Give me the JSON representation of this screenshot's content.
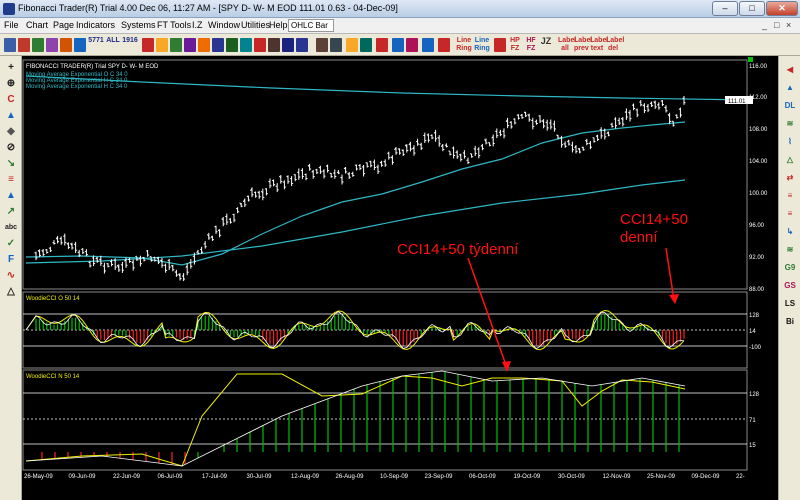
{
  "window": {
    "title": "Fibonacci Trader(R) Trial 4.00 Dec 06, 11:27 AM - [SPY D- W- M EOD  111.01   0.63 - 04-Dec-09]",
    "minimize": "–",
    "maximize": "□",
    "close": "✕"
  },
  "menu": {
    "items": [
      "File",
      "Chart",
      "Page",
      "Indicators",
      "Systems",
      "FT Tools",
      "I.Z",
      "Window",
      "Utilities",
      "Help"
    ],
    "chart_style": "OHLC Bar",
    "mdi_controls": [
      "_",
      "□",
      "×"
    ]
  },
  "toolbar": {
    "labels": [
      "5771",
      "ALL",
      "1916",
      "Line Ring",
      "Line Ring",
      "HP FZ",
      "HF FZ",
      "JZ",
      "Label all",
      "Label prev",
      "Label text",
      "Label del"
    ]
  },
  "left_tools": {
    "items": [
      "+",
      "⊕",
      "C",
      "▲",
      "◆",
      "⊘",
      "↘",
      "≡",
      "▲",
      "↗",
      "abc",
      "✓",
      "F",
      "∿",
      "△"
    ]
  },
  "right_tools": {
    "items": [
      "◀",
      "▲",
      "DL",
      "≋",
      "⌇",
      "△",
      "⇄",
      "≡",
      "≡",
      "↳",
      "≋",
      "G9",
      "GS",
      "LS",
      "Bi"
    ]
  },
  "chart": {
    "header_label": "FIBONACCI TRADER(R) Trial    SPY D- W- M EOD",
    "legend": [
      "Moving Average Exponential O C 34 0",
      "Moving Average Exponential H C 34 0",
      "Moving Average Exponential H C 34 0"
    ],
    "last_price_label": "111.01",
    "colors": {
      "background": "#000000",
      "bars": "#ffffff",
      "ma_line": "#2fb7c4",
      "cci_line": "#f0f000",
      "cci_hist": "#00c000",
      "cci_neg": "#ff2020",
      "annotation": "#ff1010",
      "grid": "#ffffff"
    },
    "price_panel": {
      "yticks": [
        "116.00",
        "112.00",
        "108.00",
        "104.00",
        "100.00",
        "96.00",
        "92.00",
        "88.00"
      ]
    },
    "cci_panel_1": {
      "label": "WoodieCCI O 50 14",
      "yticks": [
        "128",
        "14",
        "-100"
      ]
    },
    "cci_panel_2": {
      "label": "WoodieCCI N 50 14",
      "yticks": [
        "128",
        "71",
        "15"
      ]
    },
    "xticks": [
      "26-May-09",
      "09-Jun-09",
      "22-Jun-09",
      "06-Jul-09",
      "17-Jul-09",
      "30-Jul-09",
      "12-Aug-09",
      "26-Aug-09",
      "10-Sep-09",
      "23-Sep-09",
      "06-Oct-09",
      "19-Oct-09",
      "30-Oct-09",
      "12-Nov-09",
      "25-Nov-09",
      "09-Dec-09",
      "22-"
    ],
    "annotations": {
      "weekly": "CCI14+50 týdenní",
      "daily_line1": "CCI14+50",
      "daily_line2": "denní"
    }
  }
}
